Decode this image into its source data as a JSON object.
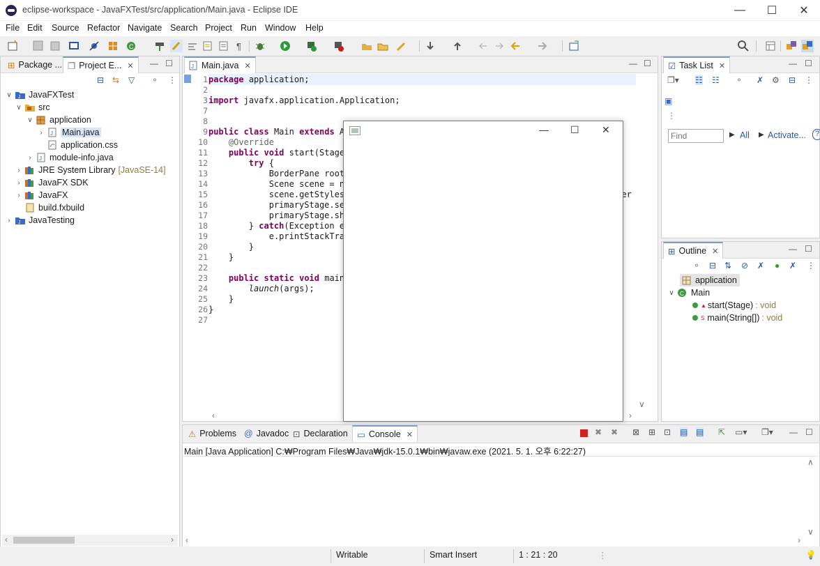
{
  "window": {
    "title": "eclipse-workspace - JavaFXTest/src/application/Main.java - Eclipse IDE",
    "min": "—",
    "max": "☐",
    "close": "✕"
  },
  "menu": [
    "File",
    "Edit",
    "Source",
    "Refactor",
    "Navigate",
    "Search",
    "Project",
    "Run",
    "Window",
    "Help"
  ],
  "explorer": {
    "tabs": [
      "Package ...",
      "Project E..."
    ],
    "tree": [
      {
        "label": "JavaFXTest",
        "extra": ""
      },
      {
        "label": "src",
        "extra": ""
      },
      {
        "label": "application",
        "extra": ""
      },
      {
        "label": "Main.java",
        "extra": ""
      },
      {
        "label": "application.css",
        "extra": ""
      },
      {
        "label": "module-info.java",
        "extra": ""
      },
      {
        "label": "JRE System Library",
        "extra": "[JavaSE-14]"
      },
      {
        "label": "JavaFX SDK",
        "extra": ""
      },
      {
        "label": "JavaFX",
        "extra": ""
      },
      {
        "label": "build.fxbuild",
        "extra": ""
      },
      {
        "label": "JavaTesting",
        "extra": ""
      }
    ]
  },
  "editor": {
    "tab": "Main.java",
    "line_numbers": [
      "1",
      "2",
      "3",
      "7",
      "8",
      "9",
      "10",
      "11",
      "12",
      "13",
      "14",
      "15",
      "16",
      "17",
      "18",
      "19",
      "20",
      "21",
      "22",
      "23",
      "24",
      "25",
      "26",
      "27"
    ],
    "lines": [
      "package application;",
      "",
      "import javafx.application.Application;",
      "",
      "",
      "public class Main extends Ap",
      "    @Override",
      "    public void start(Stage",
      "        try {",
      "            BorderPane root",
      "            Scene scene = ne",
      "            scene.getStylesh",
      "            primaryStage.set",
      "            primaryStage.sho",
      "        } catch(Exception e)",
      "            e.printStackTrac",
      "        }",
      "    }",
      "",
      "    public static void main(",
      "        launch(args);",
      "    }",
      "}",
      ""
    ],
    "overflow_text": "xter"
  },
  "task_list": {
    "tab": "Task List",
    "find_placeholder": "Find",
    "all": "All",
    "activate": "Activate..."
  },
  "outline": {
    "tab": "Outline",
    "items": [
      {
        "label": "application",
        "type": ""
      },
      {
        "label": "Main",
        "type": ""
      },
      {
        "label": "start(Stage)",
        "type": ": void"
      },
      {
        "label": "main(String[])",
        "type": ": void"
      }
    ]
  },
  "bottom": {
    "tabs": [
      "Problems",
      "Javadoc",
      "Declaration",
      "Console"
    ],
    "console_header": "Main [Java Application] C:₩Program Files₩Java₩jdk-15.0.1₩bin₩javaw.exe  (2021. 5. 1. 오후 6:22:27)"
  },
  "status": {
    "writable": "Writable",
    "insert": "Smart Insert",
    "position": "1 : 21 : 20"
  },
  "colors": {
    "keyword": "#7f0055",
    "annotation": "#646464",
    "selection_tab": "#7b9cd1"
  }
}
